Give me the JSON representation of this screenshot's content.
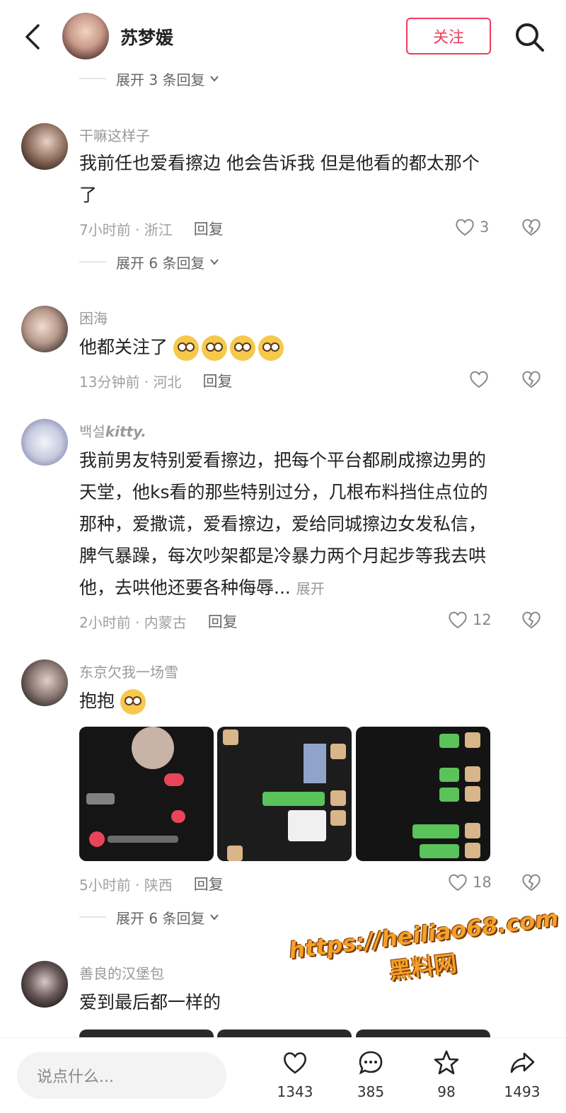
{
  "header": {
    "user_name": "苏梦媛",
    "follow_label": "关注"
  },
  "expand_top": {
    "label": "展开 3 条回复"
  },
  "comments": [
    {
      "user": "干嘛这样子",
      "text_line1": "我前任也爱看擦边 他会告诉我 但是他看的都太那个",
      "text_line2": "了",
      "meta": "7小时前 · 浙江",
      "reply": "回复",
      "likes": "3",
      "expand": "展开 6 条回复"
    },
    {
      "user": "困海",
      "text": "他都关注了",
      "meta": "13分钟前 · 河北",
      "reply": "回复",
      "likes": ""
    },
    {
      "user_prefix": "백설",
      "user_suffix": "kitty.",
      "lines": [
        "我前男友特别爱看擦边，把每个平台都刷成擦边男的",
        "天堂，他ks看的那些特别过分，几根布料挡住点位的",
        "那种，爱撒谎，爱看擦边，爱给同城擦边女发私信，",
        "脾气暴躁，每次吵架都是冷暴力两个月起步等我去哄",
        "他，去哄他还要各种侮辱..."
      ],
      "more": "展开",
      "meta": "2小时前 · 内蒙古",
      "reply": "回复",
      "likes": "12"
    },
    {
      "user": "东京欠我一场雪",
      "text": "抱抱",
      "meta": "5小时前 · 陕西",
      "reply": "回复",
      "likes": "18",
      "expand": "展开 6 条回复"
    },
    {
      "user": "善良的汉堡包",
      "text": "爱到最后都一样的"
    }
  ],
  "watermark": {
    "url": "https://heiliao68.com",
    "name": "黑料网"
  },
  "bottom_bar": {
    "input_placeholder": "说点什么...",
    "like_count": "1343",
    "comment_count": "385",
    "favorite_count": "98",
    "share_count": "1493"
  },
  "colors": {
    "accent": "#f03c5c",
    "watermark": "#f5a02a"
  },
  "icons": [
    "back-icon",
    "search-icon",
    "heart-icon",
    "dislike-heart-icon",
    "chevron-down-icon",
    "comment-icon",
    "star-icon",
    "share-icon"
  ]
}
